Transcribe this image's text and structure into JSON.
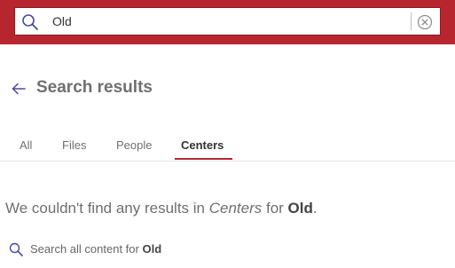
{
  "search": {
    "value": "Old",
    "placeholder": "",
    "icon": "search-icon",
    "clear_icon": "clear-circle-icon"
  },
  "colors": {
    "brand": "#b7262e",
    "accent": "#4a4a9c"
  },
  "header": {
    "back_icon": "arrow-left-icon",
    "title": "Search results"
  },
  "tabs": [
    {
      "label": "All"
    },
    {
      "label": "Files"
    },
    {
      "label": "People"
    },
    {
      "label": "Centers",
      "active": true
    }
  ],
  "message": {
    "prefix": "We couldn't find any results in ",
    "scope": "Centers",
    "middle": " for ",
    "query": "Old",
    "suffix": "."
  },
  "search_all": {
    "prefix": "Search all content for ",
    "query": "Old"
  }
}
